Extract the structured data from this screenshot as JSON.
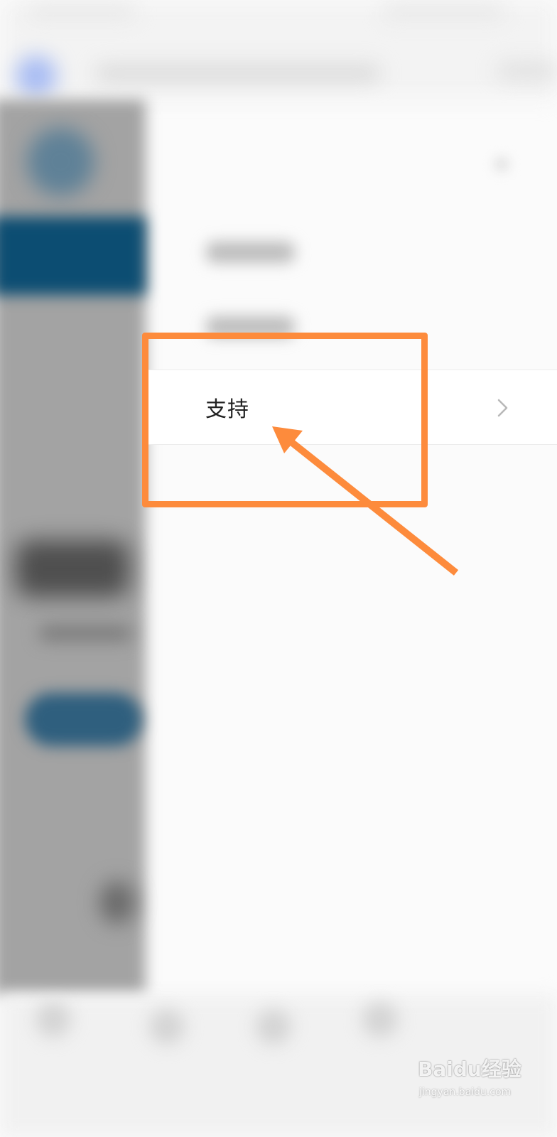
{
  "settings_menu": {
    "support_item": {
      "label": "支持",
      "chevron_icon": "chevron-right-icon"
    }
  },
  "annotation": {
    "color": "#fd8b3c",
    "shape": "rectangle-with-arrow"
  },
  "watermark": {
    "brand": "Baidu经验",
    "url": "jingyan.baidu.com"
  }
}
